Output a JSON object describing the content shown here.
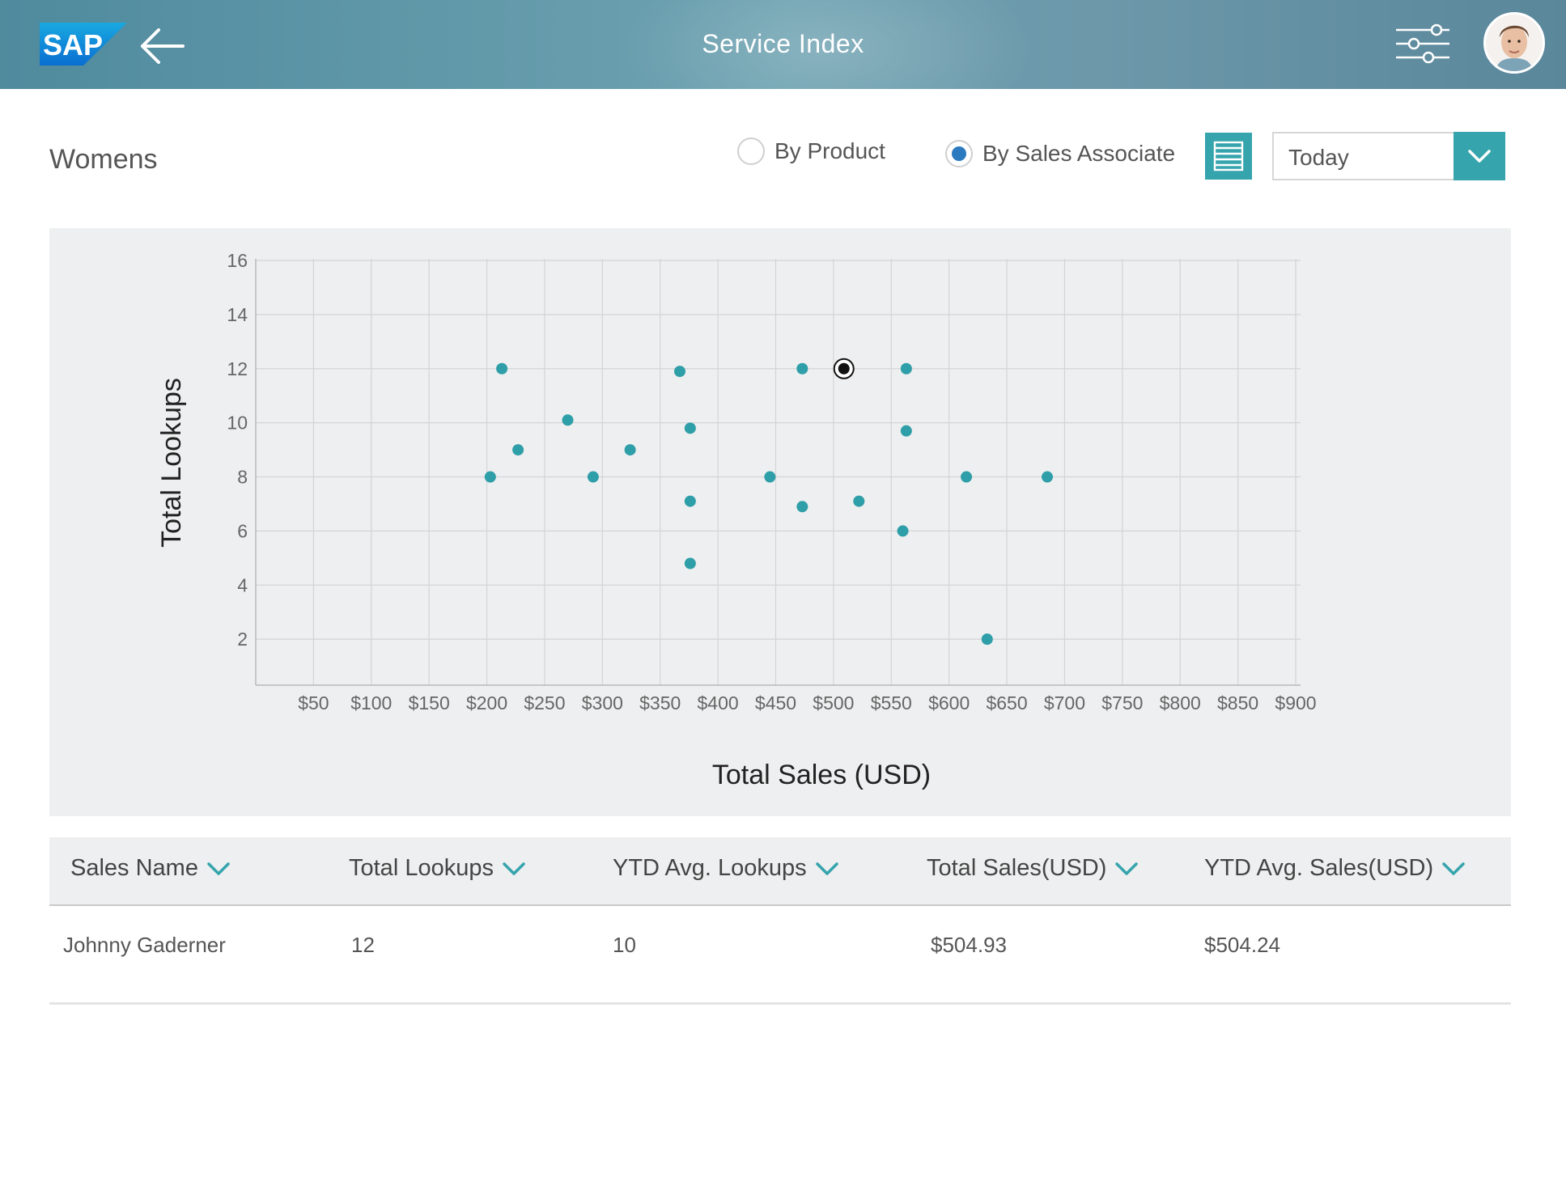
{
  "header": {
    "logo_text": "SAP",
    "title": "Service Index",
    "back_icon": "arrow-left-icon",
    "settings_icon": "sliders-icon",
    "avatar": "user-avatar"
  },
  "toolbar": {
    "section_title": "Womens",
    "radio_options": [
      {
        "label": "By Product",
        "selected": false
      },
      {
        "label": "By Sales Associate",
        "selected": true
      }
    ],
    "list_view_icon": "list-view-icon",
    "period_select": {
      "value": "Today"
    }
  },
  "colors": {
    "accent": "#35a4ad",
    "radio_selected": "#2b7ac0",
    "point": "#2e9fa8",
    "selected_point": "#111111"
  },
  "chart_data": {
    "type": "scatter",
    "title": "",
    "xlabel": "Total Sales (USD)",
    "ylabel": "Total Lookups",
    "x_ticks": [
      "$50",
      "$100",
      "$150",
      "$200",
      "$250",
      "$300",
      "$350",
      "$400",
      "$450",
      "$500",
      "$550",
      "$600",
      "$650",
      "$700",
      "$750",
      "$800",
      "$850",
      "$900"
    ],
    "y_ticks": [
      "2",
      "4",
      "6",
      "8",
      "10",
      "12",
      "14",
      "16"
    ],
    "xlim": [
      0,
      900
    ],
    "ylim": [
      0.3,
      16
    ],
    "grid": true,
    "points": [
      {
        "x": 213,
        "y": 12.0
      },
      {
        "x": 203,
        "y": 8.0
      },
      {
        "x": 227,
        "y": 9.0
      },
      {
        "x": 270,
        "y": 10.1
      },
      {
        "x": 292,
        "y": 8.0
      },
      {
        "x": 324,
        "y": 9.0
      },
      {
        "x": 367,
        "y": 11.9
      },
      {
        "x": 376,
        "y": 9.8
      },
      {
        "x": 376,
        "y": 7.1
      },
      {
        "x": 376,
        "y": 4.8
      },
      {
        "x": 445,
        "y": 8.0
      },
      {
        "x": 473,
        "y": 12.0
      },
      {
        "x": 473,
        "y": 6.9
      },
      {
        "x": 522,
        "y": 7.1
      },
      {
        "x": 560,
        "y": 6.0
      },
      {
        "x": 563,
        "y": 12.0
      },
      {
        "x": 563,
        "y": 9.7
      },
      {
        "x": 615,
        "y": 8.0
      },
      {
        "x": 633,
        "y": 2.0
      },
      {
        "x": 685,
        "y": 8.0
      },
      {
        "x": 509,
        "y": 12.0,
        "selected": true
      }
    ]
  },
  "table": {
    "columns": [
      "Sales Name",
      "Total Lookups",
      "YTD Avg. Lookups",
      "Total Sales(USD)",
      "YTD Avg. Sales(USD)"
    ],
    "rows": [
      [
        "Johnny Gaderner",
        "12",
        "10",
        "$504.93",
        "$504.24"
      ]
    ]
  }
}
